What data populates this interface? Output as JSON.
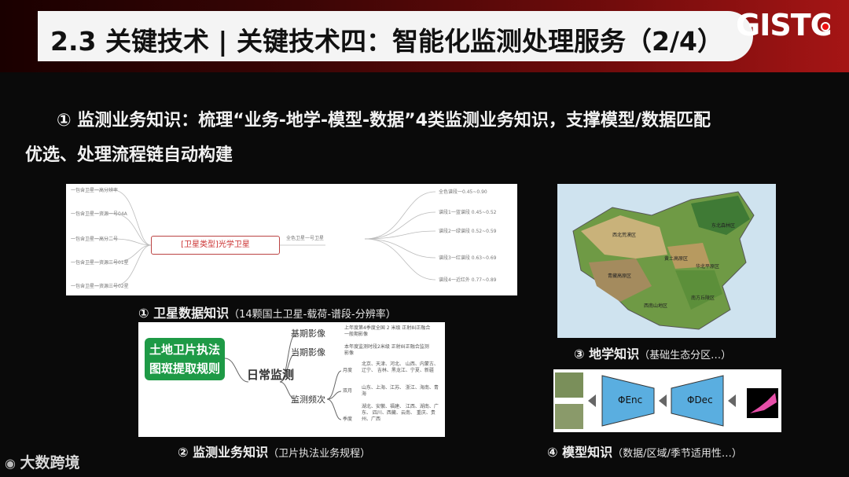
{
  "header": {
    "title": "2.3 关键技术 | 关键技术四：智能化监测处理服务（2/4）",
    "logo": "GISTC"
  },
  "subtitle": {
    "text_line1": "① 监测业务知识：梳理“业务-地学-模型-数据”4类监测业务知识，支撑模型/数据匹配",
    "text_line2": "优选、处理流程链自动构建"
  },
  "captions": {
    "c1_main": "① 卫星数据知识",
    "c1_note": "（14颗国土卫星-载荷-谱段-分辨率）",
    "c2_main": "② 监测业务知识",
    "c2_note": "（卫片执法业务规程）",
    "c3_main": "③ 地学知识",
    "c3_note": "（基础生态分区…）",
    "c4_main": "④ 模型知识",
    "c4_note": "（数据/区域/季节适用性…）"
  },
  "satellite_map": {
    "center": "[卫星类型]光学卫星",
    "branch": "全色卫星一号卫星",
    "leaves": [
      "一包含卫星一高分辨率",
      "一包含卫星一资源一号04A",
      "一包含卫星一高分二号",
      "一包含卫星一资源三号01星",
      "一包含卫星一资源三号02星"
    ],
    "right_leaves": [
      "全色谱段一0.45~0.90",
      "谱段1一蓝谱段 0.45~0.52",
      "谱段2一绿谱段 0.52~0.59",
      "谱段3一红谱段 0.63~0.69",
      "谱段4一近红外 0.77~0.89"
    ]
  },
  "rules_map": {
    "box": "土地卫片执法图斑提取规则",
    "root": "日常监测",
    "nodes": [
      "基期影像",
      "当期影像",
      "监测频次"
    ],
    "freq": [
      "月度",
      "双月",
      "季度"
    ],
    "base_note": "上年度第4季度全国 2 米级 正射纠正融合一般期影像",
    "cur_note": "本年度监测时段2米级 正射纠正融合监测影像",
    "monthly": "北京、天津、河北、 山西、内蒙古、辽宁、 吉林、黑龙江、宁夏、新疆",
    "bimonthly": "山东、上海、江苏、 浙江、海南、青海",
    "quarterly": "湖北、安徽、福建、 江西、湖南、广东、 四川、西藏、云南、 重庆、贵州、广西"
  },
  "geo_map": {
    "labels": [
      "西北荒漠区",
      "东北森林区",
      "青藏高原区",
      "黄土高原区",
      "华北平原区",
      "南方丘陵区",
      "西南山地区"
    ]
  },
  "model": {
    "enc": "ΦEnc",
    "dec": "ΦDec"
  },
  "footer": {
    "brand": "大数跨境"
  }
}
